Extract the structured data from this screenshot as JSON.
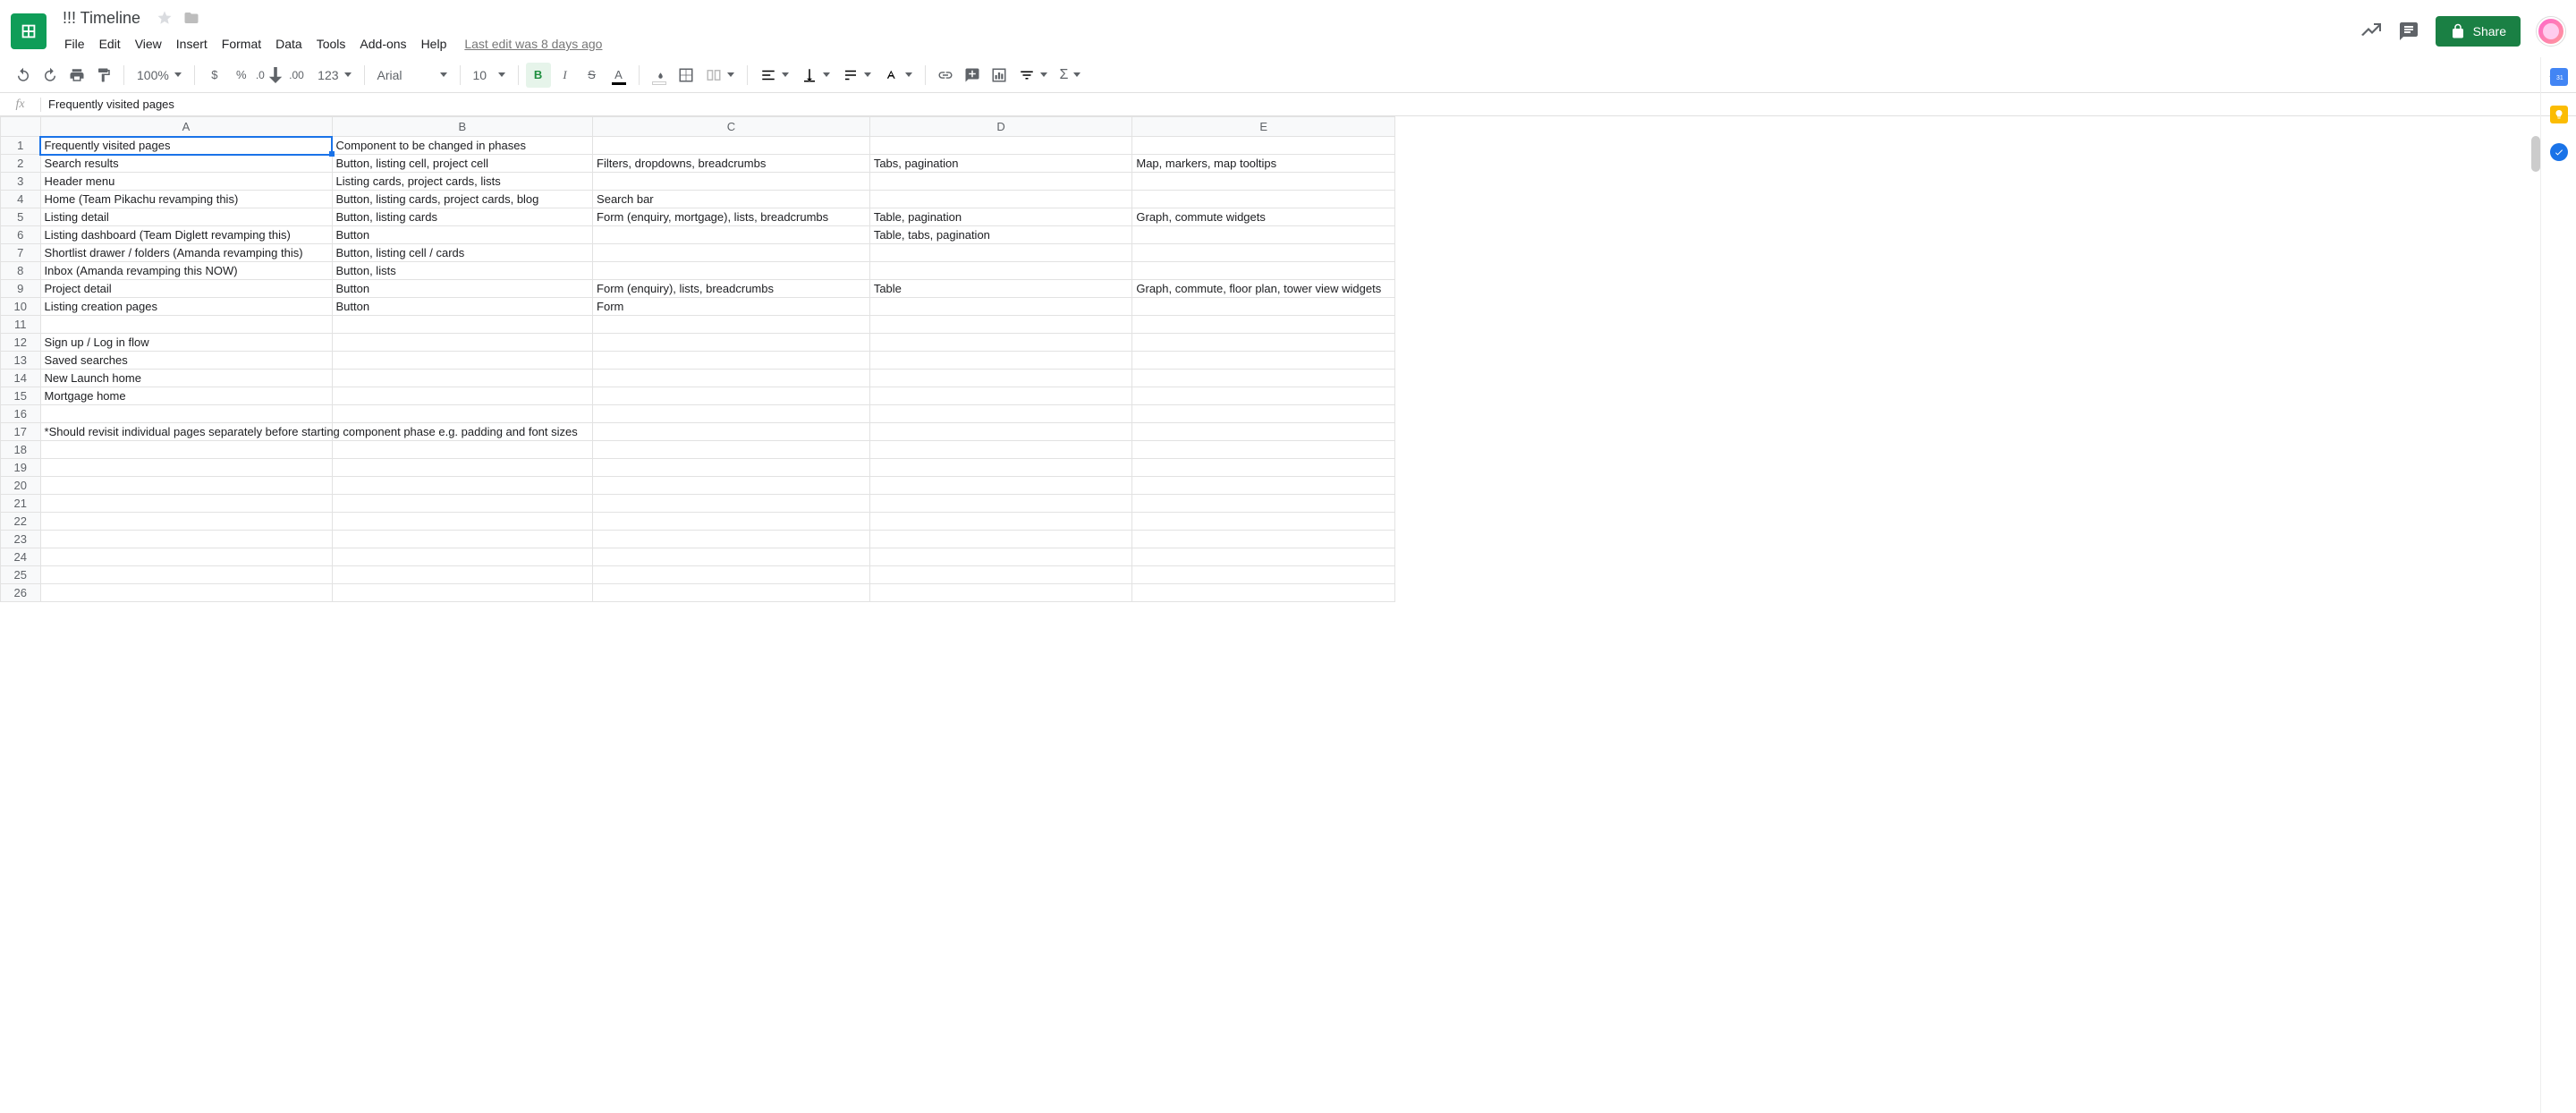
{
  "doc": {
    "title": "!!! Timeline",
    "last_edit": "Last edit was 8 days ago"
  },
  "menu": {
    "file": "File",
    "edit": "Edit",
    "view": "View",
    "insert": "Insert",
    "format": "Format",
    "data": "Data",
    "tools": "Tools",
    "addons": "Add-ons",
    "help": "Help"
  },
  "toolbar": {
    "zoom": "100%",
    "number_format": "123",
    "font": "Arial",
    "font_size": "10",
    "currency": "$",
    "percent": "%",
    "dec_less": ".0",
    "dec_more": ".00"
  },
  "share": {
    "label": "Share"
  },
  "formula_bar": {
    "fx": "fx",
    "value": "Frequently visited pages"
  },
  "columns": [
    "A",
    "B",
    "C",
    "D",
    "E"
  ],
  "row_numbers": [
    "1",
    "2",
    "3",
    "4",
    "5",
    "6",
    "7",
    "8",
    "9",
    "10",
    "11",
    "12",
    "13",
    "14",
    "15",
    "16",
    "17",
    "18",
    "19",
    "20",
    "21",
    "22",
    "23",
    "24",
    "25",
    "26"
  ],
  "cells": {
    "r1": {
      "A": "Frequently visited pages",
      "B": "Component to be changed in phases",
      "C": "",
      "D": "",
      "E": ""
    },
    "r2": {
      "A": "Search results",
      "B": "Button, listing cell, project cell",
      "C": "Filters, dropdowns, breadcrumbs",
      "D": "Tabs, pagination",
      "E": "Map, markers, map tooltips"
    },
    "r3": {
      "A": "Header menu",
      "B": "Listing cards, project cards, lists",
      "C": "",
      "D": "",
      "E": ""
    },
    "r4": {
      "A": "Home (Team Pikachu revamping this)",
      "B": "Button, listing cards, project cards, blog",
      "C": "Search bar",
      "D": "",
      "E": ""
    },
    "r5": {
      "A": "Listing detail",
      "B": "Button, listing cards",
      "C": "Form (enquiry, mortgage), lists, breadcrumbs",
      "D": "Table, pagination",
      "E": "Graph, commute widgets"
    },
    "r6": {
      "A": "Listing dashboard (Team Diglett revamping this)",
      "B": "Button",
      "C": "",
      "D": "Table, tabs, pagination",
      "E": ""
    },
    "r7": {
      "A": "Shortlist drawer / folders (Amanda revamping this)",
      "B": "Button, listing cell / cards",
      "C": "",
      "D": "",
      "E": ""
    },
    "r8": {
      "A": "Inbox (Amanda revamping this NOW)",
      "B": "Button, lists",
      "C": "",
      "D": "",
      "E": ""
    },
    "r9": {
      "A": "Project detail",
      "B": "Button",
      "C": "Form (enquiry), lists, breadcrumbs",
      "D": "Table",
      "E": "Graph, commute, floor plan, tower view widgets"
    },
    "r10": {
      "A": "Listing creation pages",
      "B": "Button",
      "C": "Form",
      "D": "",
      "E": ""
    },
    "r11": {
      "A": "",
      "B": "",
      "C": "",
      "D": "",
      "E": ""
    },
    "r12": {
      "A": "Sign up / Log in flow",
      "B": "",
      "C": "",
      "D": "",
      "E": ""
    },
    "r13": {
      "A": "Saved searches",
      "B": "",
      "C": "",
      "D": "",
      "E": ""
    },
    "r14": {
      "A": "New Launch home",
      "B": "",
      "C": "",
      "D": "",
      "E": ""
    },
    "r15": {
      "A": "Mortgage home",
      "B": "",
      "C": "",
      "D": "",
      "E": ""
    },
    "r16": {
      "A": "",
      "B": "",
      "C": "",
      "D": "",
      "E": ""
    },
    "r17": {
      "A": "*Should revisit individual pages separately before starting component phase e.g. padding and font sizes",
      "B": "",
      "C": "",
      "D": "",
      "E": ""
    },
    "r18": {
      "A": "",
      "B": "",
      "C": "",
      "D": "",
      "E": ""
    },
    "r19": {
      "A": "",
      "B": "",
      "C": "",
      "D": "",
      "E": ""
    },
    "r20": {
      "A": "",
      "B": "",
      "C": "",
      "D": "",
      "E": ""
    },
    "r21": {
      "A": "",
      "B": "",
      "C": "",
      "D": "",
      "E": ""
    },
    "r22": {
      "A": "",
      "B": "",
      "C": "",
      "D": "",
      "E": ""
    },
    "r23": {
      "A": "",
      "B": "",
      "C": "",
      "D": "",
      "E": ""
    },
    "r24": {
      "A": "",
      "B": "",
      "C": "",
      "D": "",
      "E": ""
    },
    "r25": {
      "A": "",
      "B": "",
      "C": "",
      "D": "",
      "E": ""
    },
    "r26": {
      "A": "",
      "B": "",
      "C": "",
      "D": "",
      "E": ""
    }
  }
}
